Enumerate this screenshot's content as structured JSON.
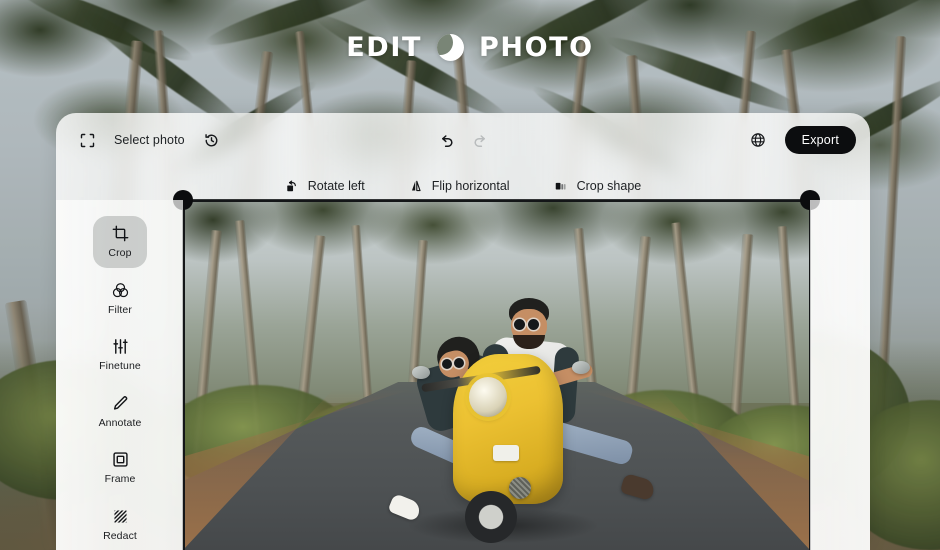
{
  "hero": {
    "word_left": "EDIT",
    "word_right": "PHOTO",
    "mark": "crescent-moon-mark"
  },
  "toolbar": {
    "select_photo_icon": "frame-select-icon",
    "select_photo_label": "Select photo",
    "history_icon": "revert-history-icon",
    "undo_icon": "undo-arrow-icon",
    "redo_icon": "redo-arrow-icon",
    "globe_icon": "globe-language-icon",
    "export_label": "Export",
    "export_color": "#0c0d0f"
  },
  "crop_options": [
    {
      "label": "Rotate left",
      "icon": "rotate-left-icon"
    },
    {
      "label": "Flip horizontal",
      "icon": "flip-horizontal-icon"
    },
    {
      "label": "Crop shape",
      "icon": "crop-shape-icon"
    }
  ],
  "tools": [
    {
      "label": "Crop",
      "icon": "crop-icon",
      "active": true
    },
    {
      "label": "Filter",
      "icon": "filter-venn-icon",
      "active": false
    },
    {
      "label": "Finetune",
      "icon": "finetune-sliders-icon",
      "active": false
    },
    {
      "label": "Annotate",
      "icon": "annotate-pencil-icon",
      "active": false
    },
    {
      "label": "Frame",
      "icon": "frame-square-icon",
      "active": false
    },
    {
      "label": "Redact",
      "icon": "redact-hatch-icon",
      "active": false
    }
  ],
  "canvas": {
    "subject": "couple riding yellow vespa scooter on palm lined road",
    "crop_handle_color": "#0b0c0e",
    "crop_border_color": "#141618"
  },
  "background": {
    "scene": "tropical palm grove with bright sky"
  }
}
